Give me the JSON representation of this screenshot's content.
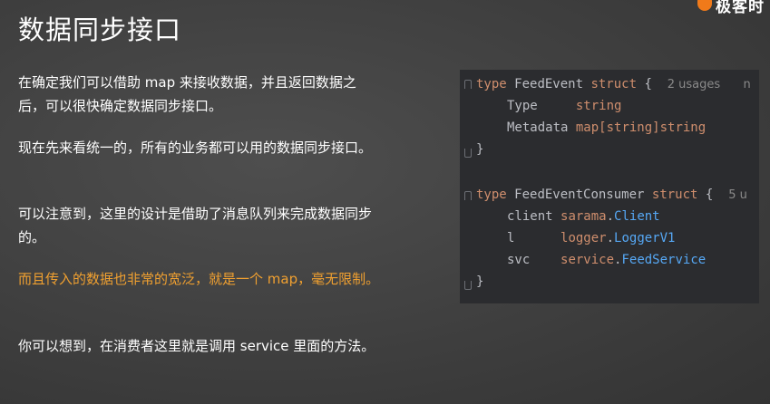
{
  "slide": {
    "title": "数据同步接口",
    "paragraphs": [
      "在确定我们可以借助 map 来接收数据，并且返回数据之后，可以很快确定数据同步接口。",
      "现在先来看统一的，所有的业务都可以用的数据同步接口。",
      "可以注意到，这里的设计是借助了消息队列来完成数据同步的。",
      "而且传入的数据也非常的宽泛，就是一个 map，毫无限制。",
      "你可以想到，在消费者这里就是调用 service 里面的方法。"
    ],
    "highlight_color": "#f0a030"
  },
  "logo": {
    "text": "极客时",
    "color": "#f07a1a"
  },
  "code": {
    "struct1": {
      "kw_type": "type",
      "name": "FeedEvent",
      "kw_struct": "struct",
      "brace_open": "{",
      "hint": "2 usages",
      "hint_tail": "n",
      "fields": [
        {
          "name": "Type",
          "type": "string"
        },
        {
          "name": "Metadata",
          "type": "map[string]string"
        }
      ],
      "brace_close": "}"
    },
    "struct2": {
      "kw_type": "type",
      "name": "FeedEventConsumer",
      "kw_struct": "struct",
      "brace_open": "{",
      "hint": "5 u",
      "fields": [
        {
          "name": "client",
          "pkg": "sarama",
          "cls": "Client"
        },
        {
          "name": "l",
          "pkg": "logger",
          "cls": "LoggerV1"
        },
        {
          "name": "svc",
          "pkg": "service",
          "cls": "FeedService"
        }
      ],
      "brace_close": "}"
    },
    "dot": "."
  }
}
